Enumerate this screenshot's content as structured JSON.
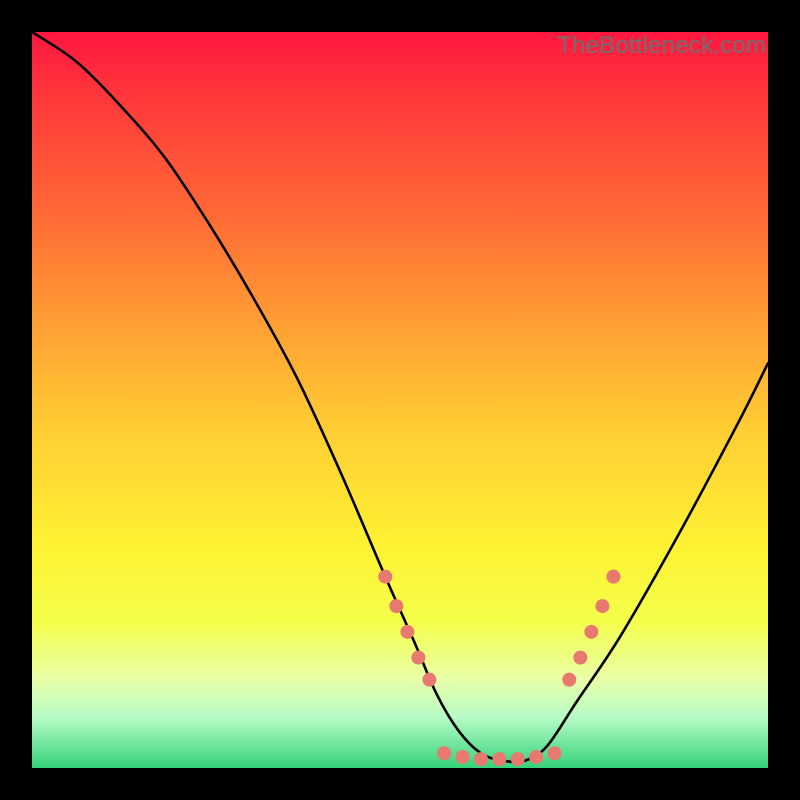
{
  "watermark": "TheBottleneck.com",
  "chart_data": {
    "type": "line",
    "title": "",
    "xlabel": "",
    "ylabel": "",
    "xlim": [
      0,
      100
    ],
    "ylim": [
      0,
      100
    ],
    "curve": {
      "name": "bottleneck-curve",
      "color": "#000000",
      "x": [
        0,
        6,
        12,
        18,
        24,
        30,
        36,
        42,
        48,
        52,
        55,
        58,
        61,
        64,
        67,
        70,
        74,
        80,
        88,
        96,
        100
      ],
      "y": [
        100,
        96,
        90,
        83,
        74,
        64,
        53,
        40,
        26,
        17,
        10,
        5,
        2,
        1,
        1,
        3,
        9,
        18,
        32,
        47,
        55
      ]
    },
    "markers": {
      "name": "highlight-dots",
      "color": "#e8796e",
      "radius": 7,
      "points": [
        {
          "x": 48.0,
          "y": 26.0
        },
        {
          "x": 49.5,
          "y": 22.0
        },
        {
          "x": 51.0,
          "y": 18.5
        },
        {
          "x": 52.5,
          "y": 15.0
        },
        {
          "x": 54.0,
          "y": 12.0
        },
        {
          "x": 56.0,
          "y": 2.0
        },
        {
          "x": 58.5,
          "y": 1.5
        },
        {
          "x": 61.0,
          "y": 1.2
        },
        {
          "x": 63.5,
          "y": 1.2
        },
        {
          "x": 66.0,
          "y": 1.2
        },
        {
          "x": 68.5,
          "y": 1.5
        },
        {
          "x": 71.0,
          "y": 2.0
        },
        {
          "x": 73.0,
          "y": 12.0
        },
        {
          "x": 74.5,
          "y": 15.0
        },
        {
          "x": 76.0,
          "y": 18.5
        },
        {
          "x": 77.5,
          "y": 22.0
        },
        {
          "x": 79.0,
          "y": 26.0
        }
      ]
    }
  }
}
